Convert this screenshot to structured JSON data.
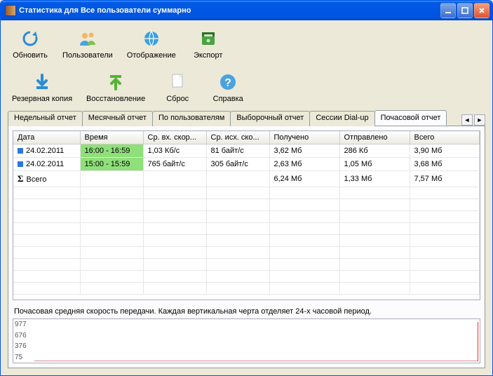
{
  "window": {
    "title": "Статистика для Все пользователи суммарно"
  },
  "toolbar": {
    "refresh": "Обновить",
    "users": "Пользователи",
    "display": "Отображение",
    "export": "Экспорт",
    "backup": "Резервная копия",
    "restore": "Восстановление",
    "reset": "Сброс",
    "help": "Справка"
  },
  "tabs": {
    "weekly": "Недельный отчет",
    "monthly": "Месячный отчет",
    "by_user": "По пользователям",
    "custom": "Выборочный отчет",
    "dialup": "Сессии Dial-up",
    "hourly": "Почасовой отчет"
  },
  "columns": {
    "date": "Дата",
    "time": "Время",
    "avg_in": "Ср. вх. скор...",
    "avg_out": "Ср. исх. ско...",
    "received": "Получено",
    "sent": "Отправлено",
    "total": "Всего"
  },
  "rows": [
    {
      "date": "24.02.2011",
      "time": "16:00 - 16:59",
      "avg_in": "1,03 Кб/с",
      "avg_out": "81 байт/с",
      "received": "3,62 Мб",
      "sent": "286 Кб",
      "total": "3,90 Мб"
    },
    {
      "date": "24.02.2011",
      "time": "15:00 - 15:59",
      "avg_in": "765 байт/с",
      "avg_out": "305 байт/с",
      "received": "2,63 Мб",
      "sent": "1,05 Мб",
      "total": "3,68 Мб"
    }
  ],
  "totals": {
    "label": "Всего",
    "received": "6,24 Мб",
    "sent": "1,33 Мб",
    "total": "7,57 Мб"
  },
  "chart": {
    "caption": "Почасовая средняя скорость передачи. Каждая вертикальная черта отделяет 24-х часовой период.",
    "ylabels": [
      "977",
      "676",
      "376",
      "75"
    ]
  }
}
